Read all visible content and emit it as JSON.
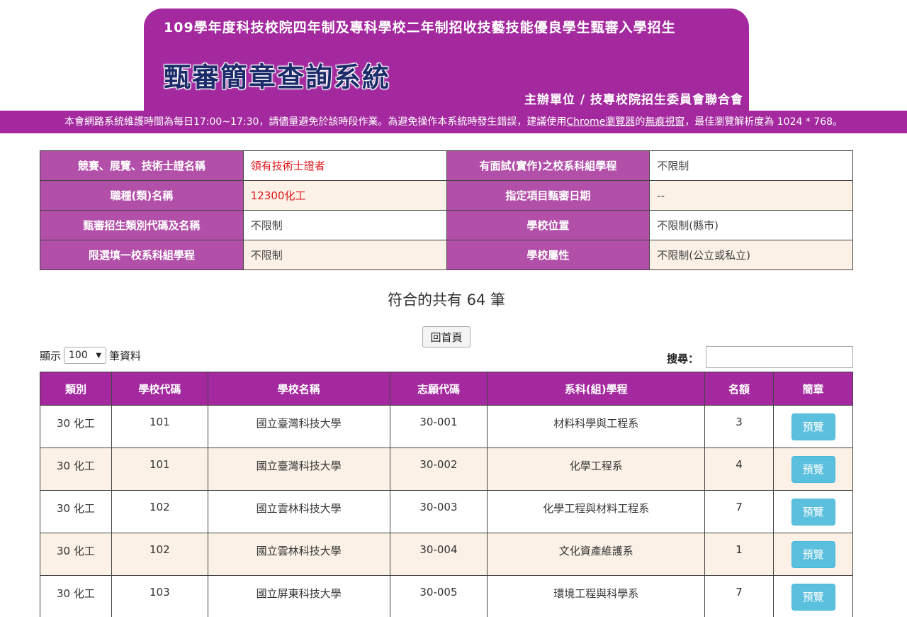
{
  "header": {
    "subtitle": "109學年度科技校院四年制及專科學校二年制招收技藝技能優良學生甄審入學招生",
    "title": "甄審簡章查詢系統",
    "organizer": "主辦單位 / 技專校院招生委員會聯合會"
  },
  "notice": {
    "part1": "本會網路系統維護時間為每日17:00~17:30，請儘量避免於該時段作業。為避免操作本系統時發生錯誤，建議使用",
    "chrome": "Chrome瀏覽器",
    "part2": "的",
    "incognito": "無痕視窗",
    "part3": "，最佳瀏覽解析度為 1024 * 768。"
  },
  "criteria": [
    {
      "l1": "競賽、展覽、技術士證名稱",
      "v1": "領有技術士證者",
      "l2": "有面試(實作)之校系科組學程",
      "v2": "不限制"
    },
    {
      "l1": "職種(類)名稱",
      "v1": "12300化工",
      "l2": "指定項目甄審日期",
      "v2": "--"
    },
    {
      "l1": "甄審招生類別代碼及名稱",
      "v1": "不限制",
      "l2": "學校位置",
      "v2": "不限制(縣市)"
    },
    {
      "l1": "限選填一校系科組學程",
      "v1": "不限制",
      "l2": "學校屬性",
      "v2": "不限制(公立或私立)"
    }
  ],
  "count_text": "符合的共有 64 筆",
  "home_button": "回首頁",
  "show": {
    "prefix": "顯示",
    "value": "100",
    "suffix": "筆資料"
  },
  "search": {
    "label": "搜尋：",
    "value": ""
  },
  "table": {
    "headers": [
      "類別",
      "學校代碼",
      "學校名稱",
      "志願代碼",
      "系科(組)學程",
      "名額",
      "簡章"
    ],
    "rows": [
      [
        "30 化工",
        "101",
        "國立臺灣科技大學",
        "30-001",
        "材料科學與工程系",
        "3",
        "預覽"
      ],
      [
        "30 化工",
        "101",
        "國立臺灣科技大學",
        "30-002",
        "化學工程系",
        "4",
        "預覽"
      ],
      [
        "30 化工",
        "102",
        "國立雲林科技大學",
        "30-003",
        "化學工程與材料工程系",
        "7",
        "預覽"
      ],
      [
        "30 化工",
        "102",
        "國立雲林科技大學",
        "30-004",
        "文化資產維護系",
        "1",
        "預覽"
      ],
      [
        "30 化工",
        "103",
        "國立屏東科技大學",
        "30-005",
        "環境工程與科學系",
        "7",
        "預覽"
      ]
    ]
  },
  "colors": {
    "primary": "#a4299f",
    "label_bg": "#b24fa8",
    "row_alt": "#fbf1e6",
    "button": "#5bc0de",
    "highlight_text": "#e0161b"
  }
}
